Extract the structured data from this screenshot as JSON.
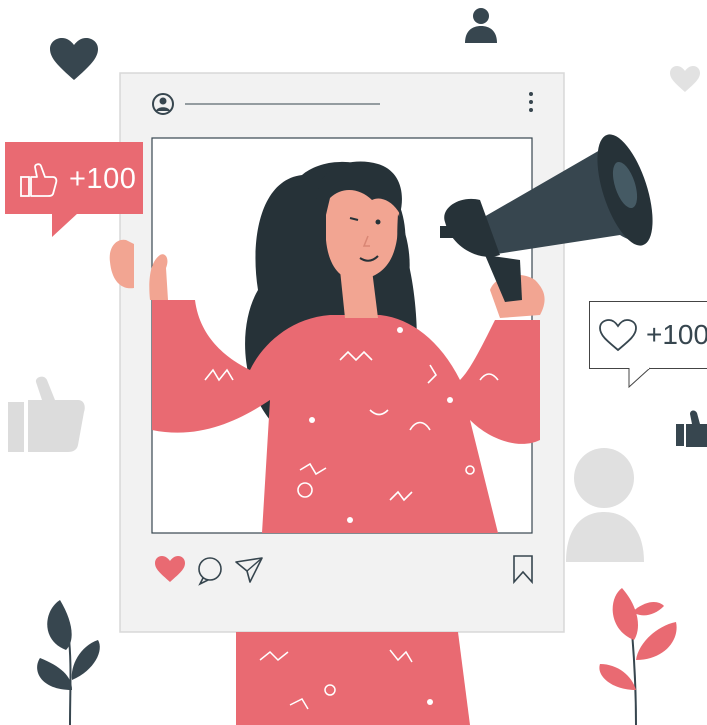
{
  "post": {
    "likes_badge": "+100",
    "hearts_badge": "+100"
  },
  "colors": {
    "accent_pink": "#e96a72",
    "dark_slate": "#37464f",
    "frame_gray": "#f2f2f2",
    "light_gray": "#e0e0e0"
  },
  "icons": [
    "user-icon",
    "heart-icon",
    "more-icon",
    "speech-bubble-icon",
    "thumbs-up-icon",
    "like-icon",
    "comment-icon",
    "share-icon",
    "bookmark-icon",
    "megaphone-icon"
  ]
}
